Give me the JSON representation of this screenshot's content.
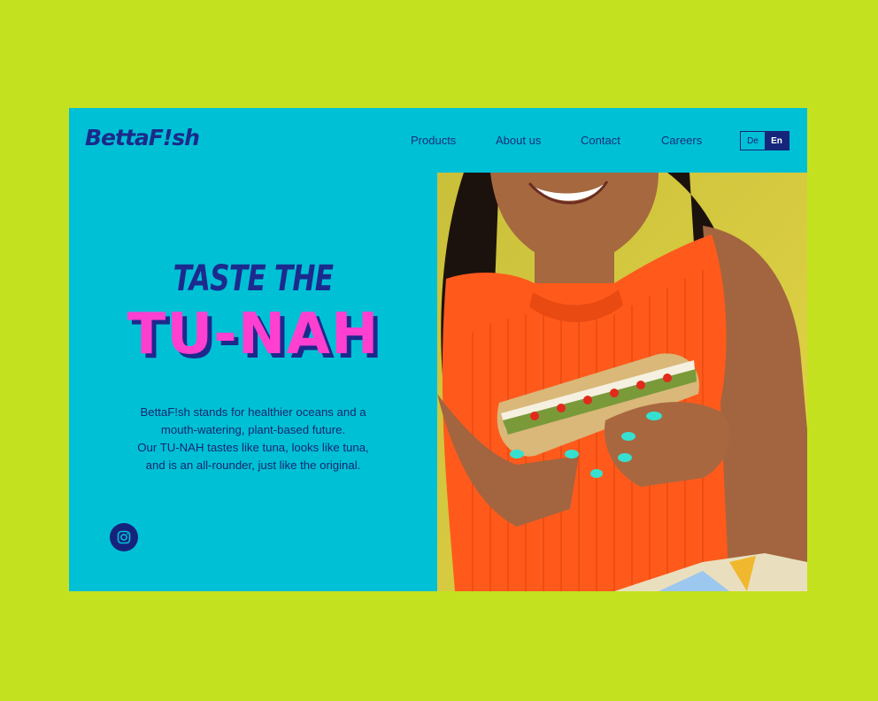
{
  "brand": {
    "logo": "BettaF!sh"
  },
  "nav": {
    "items": [
      {
        "label": "Products"
      },
      {
        "label": "About us"
      },
      {
        "label": "Contact"
      },
      {
        "label": "Careers"
      }
    ]
  },
  "language": {
    "options": [
      "De",
      "En"
    ],
    "active": "En"
  },
  "hero": {
    "headline_top": "TASTE THE",
    "headline_main": "TU-NAH",
    "paragraph_lines": [
      "BettaF!sh stands for healthier oceans and a",
      "mouth-watering, plant-based future.",
      "Our TU-NAH tastes like tuna, looks like tuna,",
      "and is an all-rounder, just like the original."
    ]
  },
  "social": {
    "icon": "instagram-icon"
  },
  "colors": {
    "page_background": "#c4e11f",
    "site_background": "#00c0d6",
    "brand_navy": "#1d2a8d",
    "accent_pink": "#ff3fd0"
  }
}
